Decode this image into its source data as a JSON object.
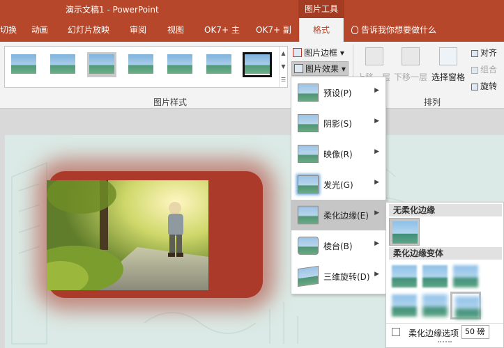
{
  "titlebar": {
    "doc_title": "演示文稿1  -  PowerPoint",
    "context_tools": "图片工具"
  },
  "tabs": {
    "transitions": "切换",
    "animations": "动画",
    "slideshow": "幻灯片放映",
    "review": "审阅",
    "view": "视图",
    "ok7_main": "OK7+ 主",
    "ok7_sub": "OK7+ 副",
    "format": "格式",
    "tellme": "告诉我你想要做什么"
  },
  "ribbon": {
    "picture_border": "图片边框",
    "picture_effects": "图片效果",
    "picture_styles_group": "图片样式",
    "align": "对齐",
    "group": "组合",
    "rotate": "旋转",
    "bring_forward": "上移一层",
    "send_backward": "下移一层",
    "selection_pane": "选择窗格",
    "arrange_group": "排列"
  },
  "effects_menu": [
    {
      "label": "预设(P)",
      "icon": "preset-icon"
    },
    {
      "label": "阴影(S)",
      "icon": "shadow-icon"
    },
    {
      "label": "映像(R)",
      "icon": "reflection-icon"
    },
    {
      "label": "发光(G)",
      "icon": "glow-icon"
    },
    {
      "label": "柔化边缘(E)",
      "icon": "soft-edges-icon"
    },
    {
      "label": "棱台(B)",
      "icon": "bevel-icon"
    },
    {
      "label": "三维旋转(D)",
      "icon": "3d-rotation-icon"
    }
  ],
  "soft_edges_submenu": {
    "no_soft_edges": "无柔化边缘",
    "variations": "柔化边缘变体",
    "options_label": "柔化边缘选项",
    "value": "50 磅"
  },
  "colors": {
    "accent": "#b7472a",
    "slide_bg": "#dbeae6"
  }
}
